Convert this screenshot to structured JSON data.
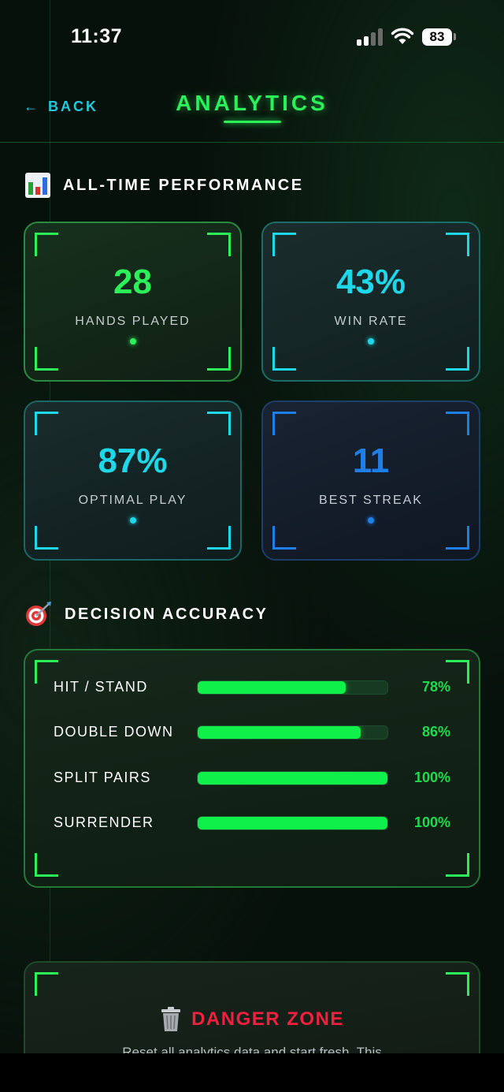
{
  "status_bar": {
    "time": "11:37",
    "battery": "83"
  },
  "header": {
    "back_label": "BACK",
    "back_arrow": "←",
    "title": "ANALYTICS"
  },
  "performance": {
    "heading": "ALL-TIME PERFORMANCE",
    "icon": "bar-chart-icon",
    "cards": [
      {
        "value": "28",
        "label": "HANDS PLAYED",
        "color": "#2cf05a"
      },
      {
        "value": "43%",
        "label": "WIN RATE",
        "color": "#1ed8ea"
      },
      {
        "value": "87%",
        "label": "OPTIMAL PLAY",
        "color": "#1ed8ea"
      },
      {
        "value": "11",
        "label": "BEST STREAK",
        "color": "#1f7fe6"
      }
    ]
  },
  "accuracy": {
    "heading": "DECISION ACCURACY",
    "icon": "target-icon",
    "rows": [
      {
        "label": "HIT / STAND",
        "percent": 78,
        "text": "78%"
      },
      {
        "label": "DOUBLE DOWN",
        "percent": 86,
        "text": "86%"
      },
      {
        "label": "SPLIT PAIRS",
        "percent": 100,
        "text": "100%"
      },
      {
        "label": "SURRENDER",
        "percent": 100,
        "text": "100%"
      }
    ]
  },
  "danger": {
    "icon": "trash-icon",
    "title": "DANGER ZONE",
    "description": "Reset all analytics data and start fresh. This"
  }
}
